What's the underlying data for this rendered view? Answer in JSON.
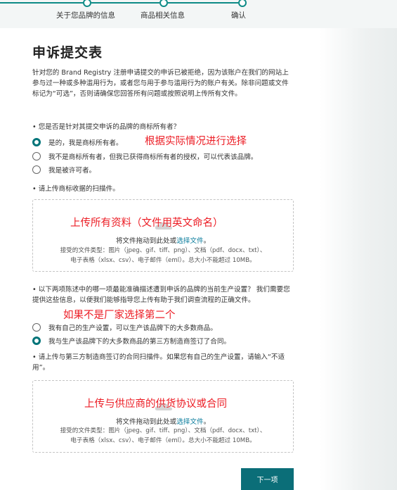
{
  "stepper": {
    "steps": [
      "关于您品牌的信息",
      "商品相关信息",
      "确认"
    ]
  },
  "form": {
    "title": "申诉提交表",
    "intro": "针对您的 Brand Registry 注册申请提交的申诉已被拒绝，因为该账户在我们的网站上参与过一种或多种滥用行为，或者您与用于参与滥用行为的账户有关。除非问题或文件标记为“可选”，否则请确保您回答所有问题或按照说明上传所有文件。",
    "q1": {
      "label": "• 您是否是针对其提交申诉的品牌的商标所有者？",
      "options": [
        "是的，我是商标所有者。",
        "我不是商标所有者，但我已获得商标所有者的授权，可以代表该品牌。",
        "我是被许可者。"
      ],
      "selected": 0
    },
    "upload1": {
      "label": "• 请上传商标收据的扫描件。",
      "drag_text": "将文件拖动到此处或",
      "link_text": "选择文件",
      "period": "。",
      "types_line1": "接受的文件类型：图片（jpeg、gif、tiff、png）、文档（pdf、docx、txt）、",
      "types_line2": "电子表格（xlsx、csv）、电子邮件（eml）。总大小不能超过 10MB。"
    },
    "q2": {
      "label": "• 以下两项陈述中的哪一项最能准确描述遭到申诉的品牌的当前生产设置？ 我们需要您提供这些信息，以便我们能够指导您上传有助于我们调查流程的正确文件。",
      "options": [
        "我有自己的生产设置，可以生产该品牌下的大多数商品。",
        "我与生产该品牌下的大多数商品的第三方制造商签订了合同。"
      ],
      "selected": 1
    },
    "upload2": {
      "label": "• 请上传与第三方制造商签订的合同扫描件。如果您有自己的生产设置，请输入“不适用”。",
      "drag_text": "将文件拖动到此处或",
      "link_text": "选择文件",
      "period": "。",
      "types_line1": "接受的文件类型：图片（jpeg、gif、tiff、png）、文档（pdf、docx、txt）、",
      "types_line2": "电子表格（xlsx、csv）、电子邮件（eml）。总大小不能超过 10MB。"
    },
    "next_button": "下一项"
  },
  "annotations": {
    "a1": "根据实际情况进行选择",
    "a2": "上传所有资料（文件用英文命名）",
    "a3": "如果不是厂家选择第二个",
    "a4": "上传与供应商的供货协议或合同"
  },
  "colors": {
    "accent": "#0d8b86",
    "button": "#0b6e78",
    "annotation": "#ec1c24",
    "link": "#0a7c9c"
  }
}
